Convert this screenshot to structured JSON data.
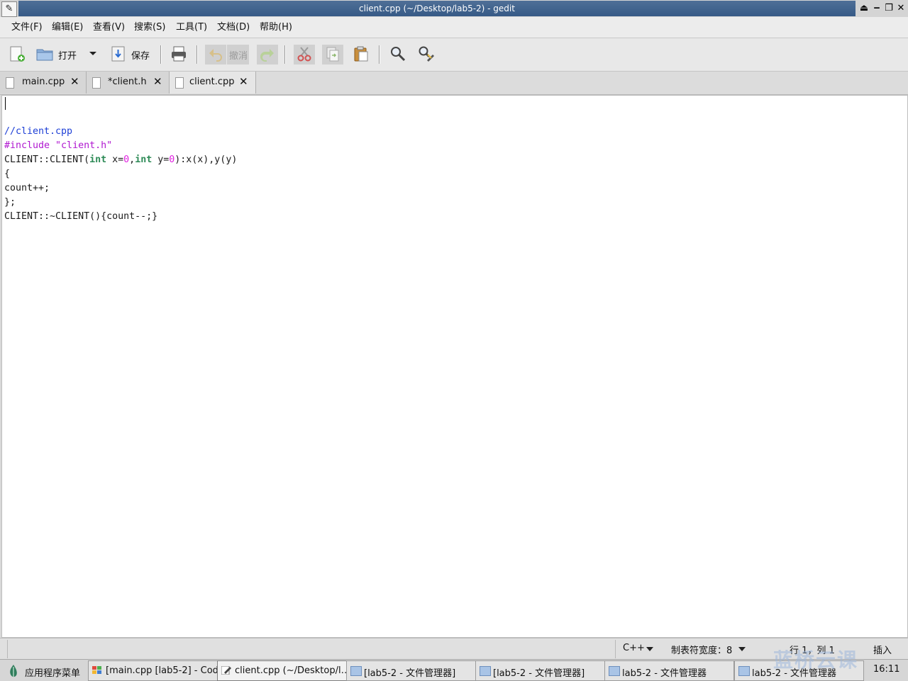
{
  "window": {
    "title": "client.cpp (~/Desktop/lab5-2) - gedit",
    "controls": [
      "⏏",
      "‒",
      "❐",
      "✕"
    ]
  },
  "menu": [
    "文件(F)",
    "编辑(E)",
    "查看(V)",
    "搜索(S)",
    "工具(T)",
    "文档(D)",
    "帮助(H)"
  ],
  "toolbar": {
    "open_label": "打开",
    "save_label": "保存",
    "undo_label": "撤消"
  },
  "tabs": [
    {
      "name": "main.cpp",
      "active": false
    },
    {
      "name": "*client.h",
      "active": false
    },
    {
      "name": "client.cpp",
      "active": true
    }
  ],
  "editor": {
    "lines": [
      "",
      "//client.cpp",
      "#include \"client.h\"",
      "CLIENT::CLIENT(int x=0,int y=0):x(x),y(y)",
      "{",
      "count++;",
      "};",
      "CLIENT::~CLIENT(){count--;}"
    ]
  },
  "statusbar": {
    "language": "C++",
    "tab_width": "制表符宽度：8",
    "position": "行 1，列 1",
    "mode": "插入"
  },
  "taskbar": {
    "start_label": "应用程序菜单",
    "tasks": [
      {
        "label": "[main.cpp [lab5-2] - Cod…",
        "icon": "codeblocks-icon",
        "active": false
      },
      {
        "label": "client.cpp (~/Desktop/l…",
        "icon": "gedit-icon",
        "active": true
      },
      {
        "label": "[lab5-2 - 文件管理器]",
        "icon": "folder-icon",
        "active": false
      },
      {
        "label": "[lab5-2 - 文件管理器]",
        "icon": "folder-icon",
        "active": false
      },
      {
        "label": "lab5-2 - 文件管理器",
        "icon": "folder-icon",
        "active": false
      },
      {
        "label": "lab5-2 - 文件管理器",
        "icon": "folder-icon",
        "active": false
      }
    ],
    "clock": "16:11"
  },
  "watermark": "蓝桥云课",
  "colors": {
    "titlebar": "#3e6191",
    "comment": "#1d3fd6",
    "preprocessor": "#b018d0",
    "type": "#2e8b57",
    "number": "#e020e0"
  }
}
